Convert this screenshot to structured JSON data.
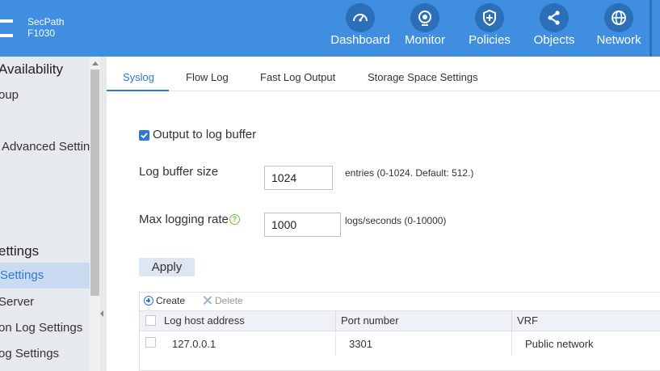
{
  "header": {
    "product_line1": "SecPath",
    "product_line2": "F1030",
    "nav": [
      {
        "label": "Dashboard",
        "icon": "dashboard-gauge-icon"
      },
      {
        "label": "Monitor",
        "icon": "monitor-eye-icon"
      },
      {
        "label": "Policies",
        "icon": "shield-plus-icon"
      },
      {
        "label": "Objects",
        "icon": "share-nodes-icon"
      },
      {
        "label": "Network",
        "icon": "globe-icon"
      }
    ],
    "colors": {
      "bar": "#3f8ee0",
      "icon_bg": "#2a6fb8"
    }
  },
  "sidebar": {
    "items": [
      {
        "label": "Availability"
      },
      {
        "label": "oup"
      },
      {
        "label": "Advanced Settin"
      },
      {
        "label": "ettings"
      },
      {
        "label": "Settings"
      },
      {
        "label": "Server"
      },
      {
        "label": "on Log Settings"
      },
      {
        "label": "og Settings"
      }
    ]
  },
  "tabs": [
    {
      "label": "Syslog"
    },
    {
      "label": "Flow Log"
    },
    {
      "label": "Fast Log Output"
    },
    {
      "label": "Storage Space Settings"
    }
  ],
  "form": {
    "output_to_buffer_label": "Output to log buffer",
    "output_to_buffer_checked": true,
    "buffer_size_label": "Log buffer size",
    "buffer_size_value": "1024",
    "buffer_size_hint": "entries (0-1024. Default: 512.)",
    "max_rate_label": "Max logging rate",
    "max_rate_value": "1000",
    "max_rate_hint": "logs/seconds (0-10000)",
    "apply_label": "Apply"
  },
  "table": {
    "create_label": "Create",
    "delete_label": "Delete",
    "columns": [
      "Log host address",
      "Port number",
      "VRF"
    ],
    "rows": [
      {
        "address": "127.0.0.1",
        "port": "3301",
        "vrf": "Public network"
      }
    ]
  },
  "accent_color": "#2f7ad0"
}
